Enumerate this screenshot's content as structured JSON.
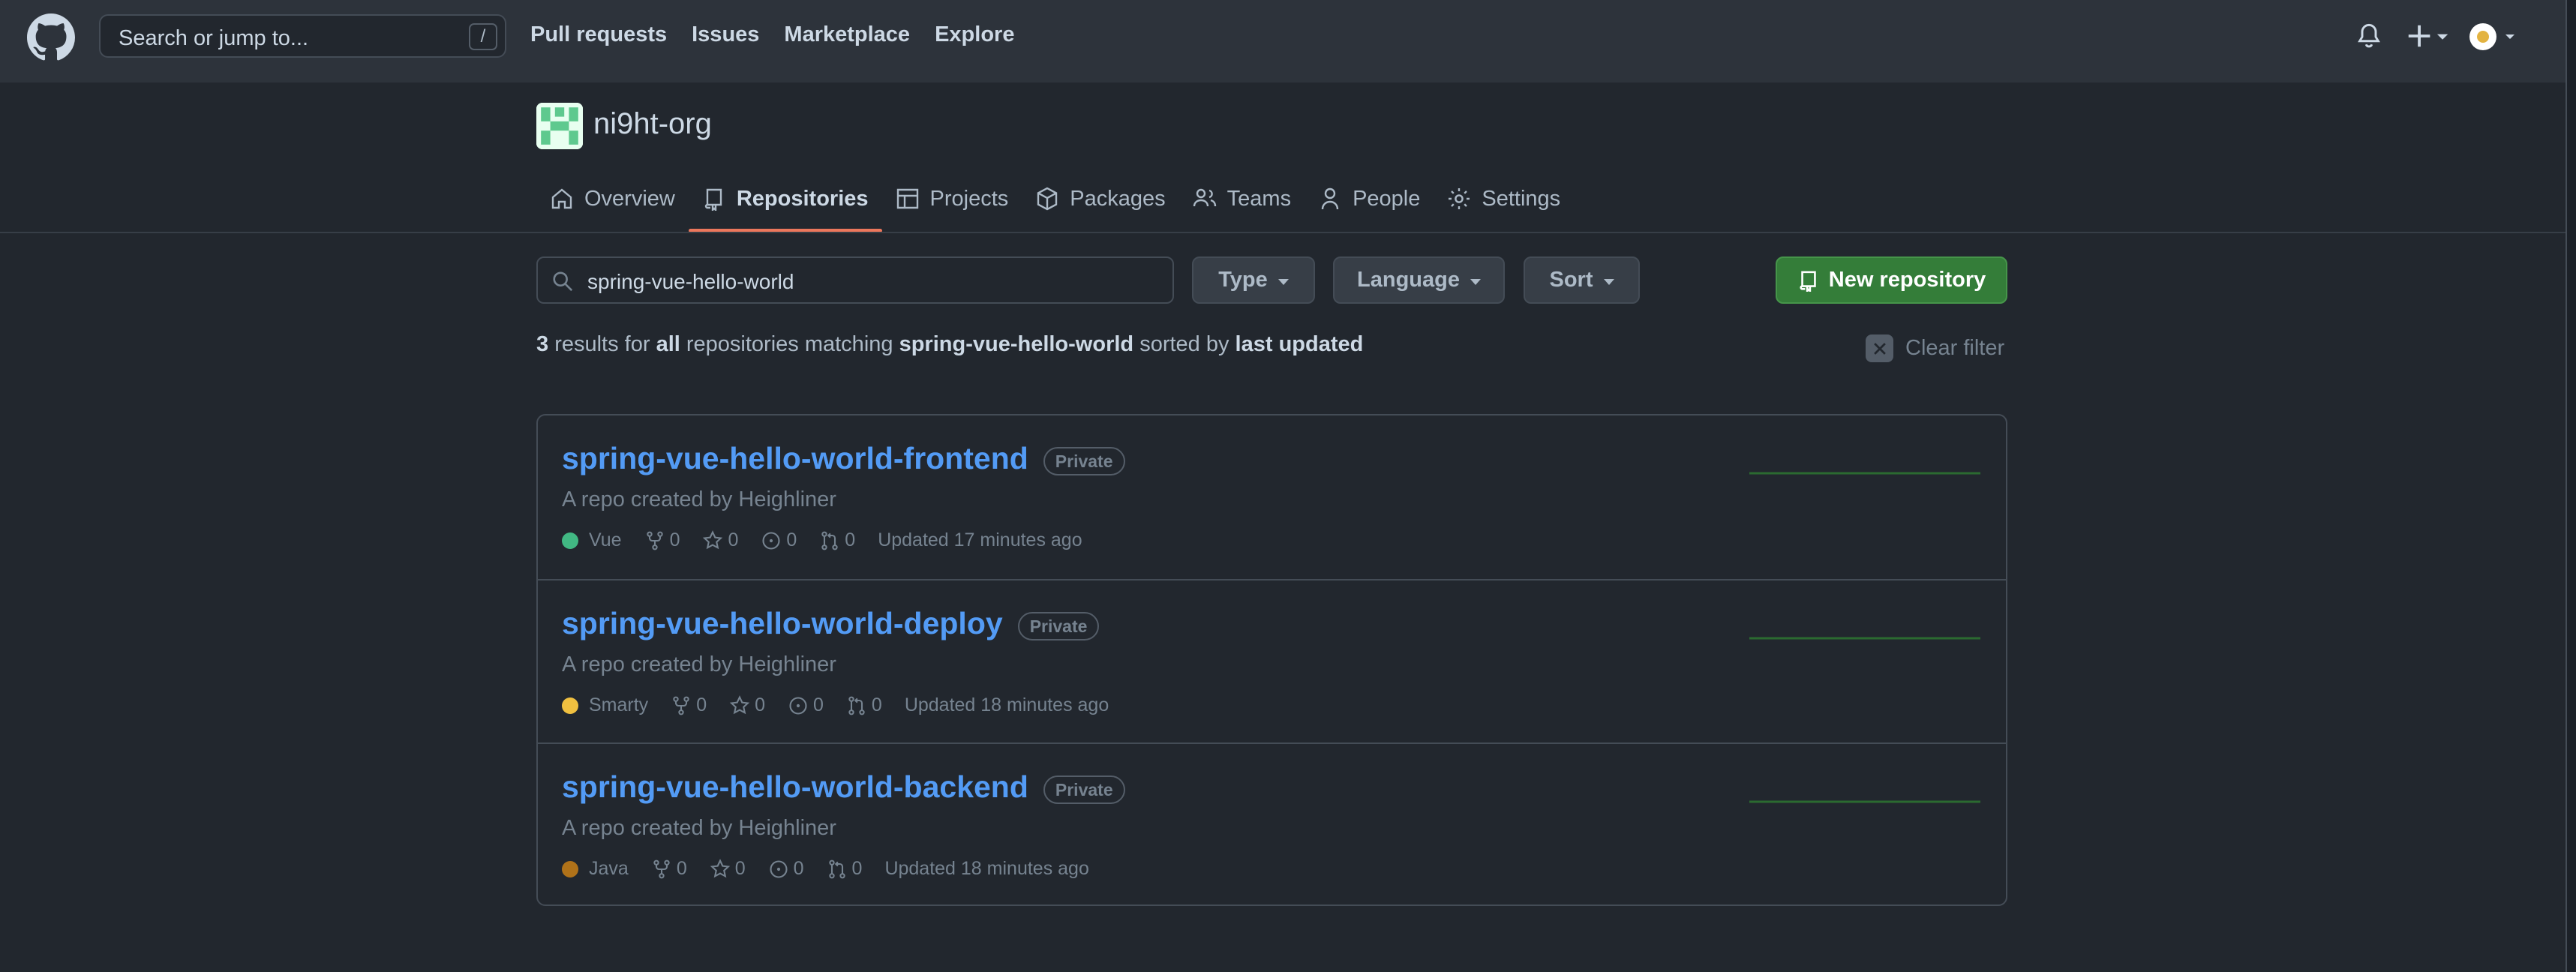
{
  "header": {
    "search_placeholder": "Search or jump to...",
    "search_shortcut": "/",
    "nav": [
      "Pull requests",
      "Issues",
      "Marketplace",
      "Explore"
    ]
  },
  "org": {
    "name": "ni9ht-org",
    "tabs": [
      {
        "label": "Overview",
        "icon": "home-icon"
      },
      {
        "label": "Repositories",
        "icon": "repo-icon",
        "active": true
      },
      {
        "label": "Projects",
        "icon": "table-icon"
      },
      {
        "label": "Packages",
        "icon": "package-icon"
      },
      {
        "label": "Teams",
        "icon": "people-icon"
      },
      {
        "label": "People",
        "icon": "person-icon"
      },
      {
        "label": "Settings",
        "icon": "gear-icon"
      }
    ]
  },
  "filters": {
    "search_value": "spring-vue-hello-world",
    "type_label": "Type",
    "language_label": "Language",
    "sort_label": "Sort",
    "new_repo_label": "New repository"
  },
  "summary": {
    "count": "3",
    "text1": " results for ",
    "scope": "all",
    "text2": " repositories matching ",
    "query": "spring-vue-hello-world",
    "text3": " sorted by ",
    "sort": "last updated"
  },
  "clear_filter_label": "Clear filter",
  "repos": [
    {
      "name": "spring-vue-hello-world-frontend",
      "visibility": "Private",
      "description": "A repo created by Heighliner",
      "language": "Vue",
      "language_color": "#41b883",
      "forks": "0",
      "stars": "0",
      "issues": "0",
      "prs": "0",
      "updated": "Updated 17 minutes ago"
    },
    {
      "name": "spring-vue-hello-world-deploy",
      "visibility": "Private",
      "description": "A repo created by Heighliner",
      "language": "Smarty",
      "language_color": "#f0c040",
      "forks": "0",
      "stars": "0",
      "issues": "0",
      "prs": "0",
      "updated": "Updated 18 minutes ago"
    },
    {
      "name": "spring-vue-hello-world-backend",
      "visibility": "Private",
      "description": "A repo created by Heighliner",
      "language": "Java",
      "language_color": "#b07219",
      "forks": "0",
      "stars": "0",
      "issues": "0",
      "prs": "0",
      "updated": "Updated 18 minutes ago"
    }
  ],
  "colors": {
    "accent_tab": "#ec775c",
    "link": "#539bf5",
    "primary_button": "#347d39",
    "sparkline": "#2b6a30"
  }
}
